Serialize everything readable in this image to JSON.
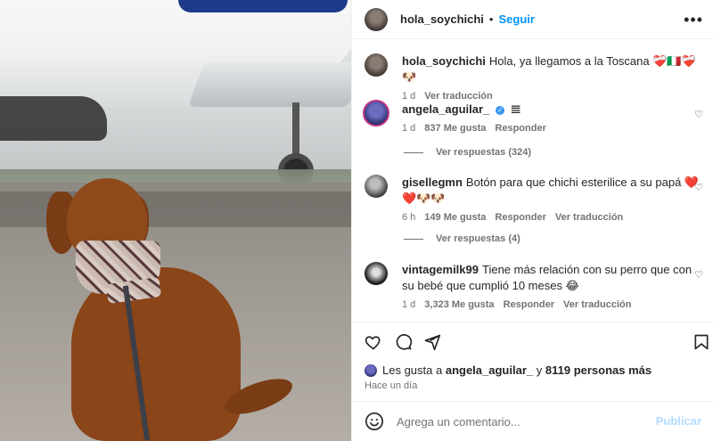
{
  "post": {
    "username": "hola_soychichi",
    "follow_label": "Seguir",
    "more_label": "•••"
  },
  "caption": {
    "username": "hola_soychichi",
    "text": "Hola, ya llegamos a la Toscana ❤️‍🩹🇮🇹❤️‍🩹🐶",
    "time": "1 d",
    "translate": "Ver traducción"
  },
  "comments": [
    {
      "username": "angela_aguilar_",
      "text": "𝌆",
      "time": "1 d",
      "likes": "837 Me gusta",
      "reply": "Responder",
      "replies": "Ver respuestas (324)"
    },
    {
      "username": "gisellegmn",
      "text": "Botón para que chichi esterilice a su papá ❤️❤️🐶🐶",
      "time": "6 h",
      "likes": "149 Me gusta",
      "reply": "Responder",
      "translate": "Ver traducción",
      "replies": "Ver respuestas (4)"
    },
    {
      "username": "vintagemilk99",
      "text": "Tiene más relación con su perro que con su bebé que cumplió 10 meses 😂",
      "time": "1 d",
      "likes": "3,323 Me gusta",
      "reply": "Responder",
      "translate": "Ver traducción"
    }
  ],
  "likes_summary": {
    "prefix": "Les gusta a",
    "user": "angela_aguilar_",
    "middle": "y",
    "rest": "8119 personas más"
  },
  "time_ago": "Hace un día",
  "add_comment": {
    "placeholder": "Agrega un comentario...",
    "publish": "Publicar"
  },
  "icons": [
    "heart-icon",
    "comment-icon",
    "share-icon",
    "save-icon",
    "emoji-icon",
    "more-icon",
    "verified-icon"
  ]
}
